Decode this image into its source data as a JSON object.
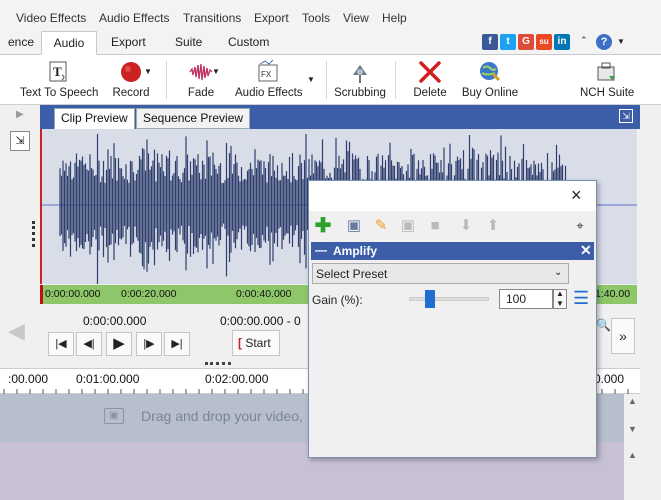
{
  "menu": [
    "Video Effects",
    "Audio Effects",
    "Transitions",
    "Export",
    "Tools",
    "View",
    "Help"
  ],
  "tabs": [
    {
      "label": "ence",
      "active": false
    },
    {
      "label": "Audio",
      "active": true
    },
    {
      "label": "Export",
      "active": false
    },
    {
      "label": "Suite",
      "active": false
    },
    {
      "label": "Custom",
      "active": false
    }
  ],
  "social": {
    "facebook": "f",
    "twitter": "t",
    "google": "G",
    "stumble": "su",
    "linkedin": "in",
    "help": "?"
  },
  "toolbar": {
    "text_to_speech": "Text To Speech",
    "record": "Record",
    "fade": "Fade",
    "audio_effects": "Audio Effects",
    "scrubbing": "Scrubbing",
    "delete": "Delete",
    "buy_online": "Buy Online",
    "nch_suite": "NCH Suite",
    "fx_glyph": "FX"
  },
  "preview": {
    "clip_tab": "Clip Preview",
    "sequence_tab": "Sequence Preview",
    "ruler_marks": [
      "0:00:00.000",
      "0:00:20.000",
      "0:00:40.000",
      "1:40.00"
    ],
    "time_current": "0:00:00.000",
    "time_range": "0:00:00.000  -  0",
    "start_label": "Start"
  },
  "timeline": {
    "ruler_marks": [
      ":00.000",
      "0:01:00.000",
      "0:02:00.000",
      "0.000"
    ],
    "drop_hint": "Drag and drop your video,"
  },
  "dialog": {
    "close_glyph": "×",
    "effect_title": "Amplify",
    "preset_placeholder": "Select Preset",
    "gain_label": "Gain (%):",
    "gain_value": "100",
    "gain_slider_fraction": 0.16
  },
  "colors": {
    "accent_blue": "#3c5ea8",
    "ruler_green": "#8dc76a",
    "waveform": "#2e3f6e",
    "record_red": "#cc2222"
  }
}
